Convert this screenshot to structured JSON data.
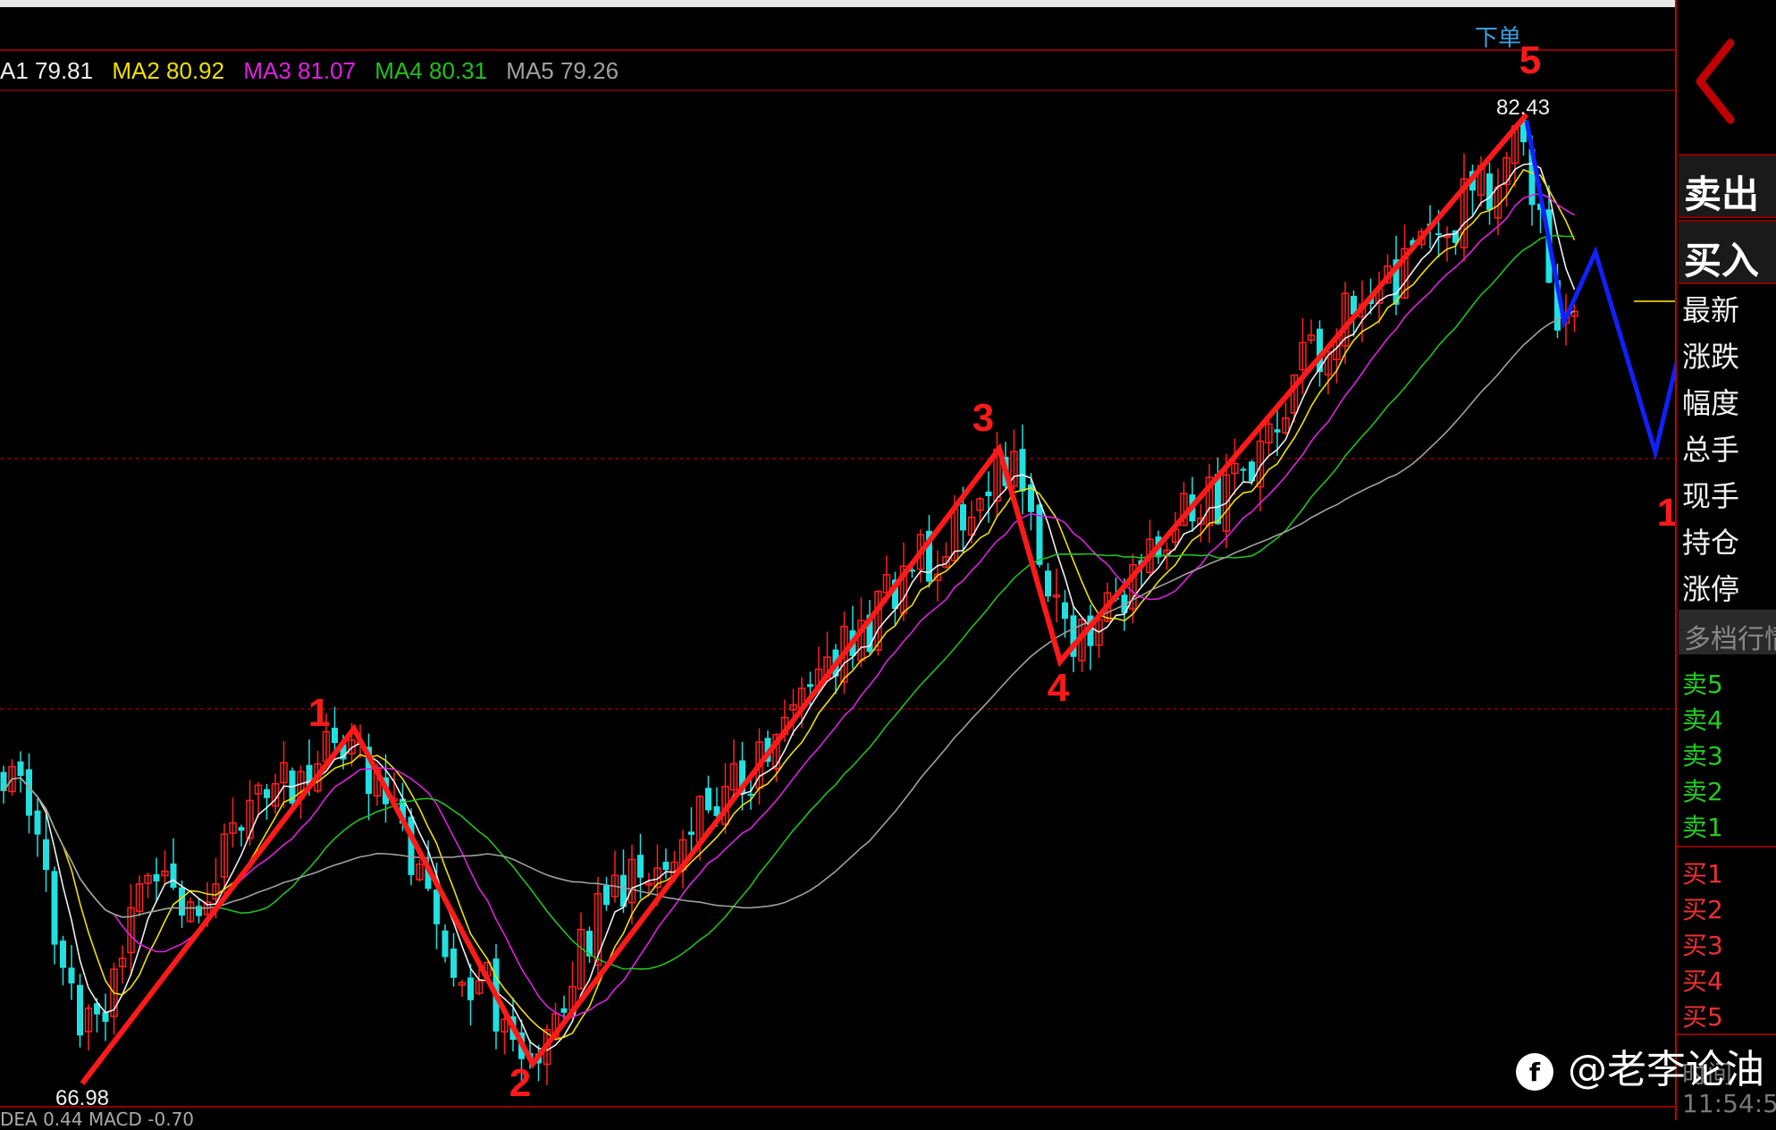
{
  "header": {
    "order_label": "下单"
  },
  "ma_legend": [
    {
      "label": "A1 79.81",
      "color": "#f0f0f0"
    },
    {
      "label": "MA2 80.92",
      "color": "#f0e000"
    },
    {
      "label": "MA3 81.07",
      "color": "#e020e0"
    },
    {
      "label": "MA4 80.31",
      "color": "#20c020"
    },
    {
      "label": "MA5 79.26",
      "color": "#a0a0a0"
    }
  ],
  "chart_labels": {
    "high": "82.43",
    "low": "66.98",
    "wave_1": "1",
    "wave_2": "2",
    "wave_3": "3",
    "wave_4": "4",
    "wave_5": "5",
    "blue_1": "1"
  },
  "panel": {
    "sell_button": "卖出",
    "buy_button": "买入",
    "fields": [
      "最新",
      "涨跌",
      "幅度",
      "总手",
      "现手",
      "持仓",
      "涨停"
    ],
    "multi_level": "多档行情",
    "sell_levels": [
      "卖5",
      "卖4",
      "卖3",
      "卖2",
      "卖1"
    ],
    "buy_levels": [
      "买1",
      "买2",
      "买3",
      "买4",
      "买5"
    ],
    "time_label": "时间",
    "time_value": "11:54:5"
  },
  "watermark": "@老李论油",
  "bottom_text": "DEA 0.44  MACD -0.70",
  "colors": {
    "up": "#ff2020",
    "down": "#20e0e0",
    "wave": "#ff1a1a",
    "forecast": "#1020ff"
  }
}
